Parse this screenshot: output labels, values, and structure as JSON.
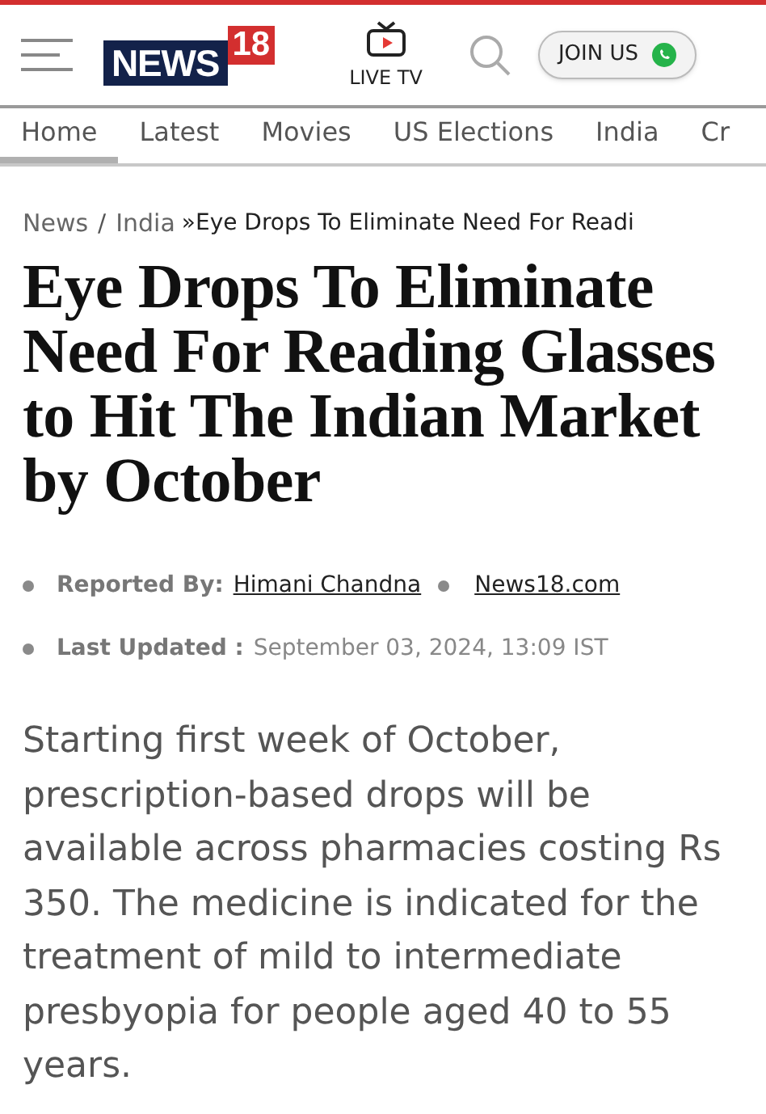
{
  "header": {
    "logo": {
      "word": "NEWS",
      "number": "18"
    },
    "live_tv": "LIVE TV",
    "join_button": "JOIN US"
  },
  "nav": [
    {
      "label": "Home",
      "selected": true
    },
    {
      "label": "Latest",
      "selected": false
    },
    {
      "label": "Movies",
      "selected": false
    },
    {
      "label": "US Elections",
      "selected": false
    },
    {
      "label": "India",
      "selected": false
    },
    {
      "label": "Cr",
      "selected": false
    }
  ],
  "breadcrumb": {
    "items": [
      "News",
      "India"
    ],
    "separator": "/",
    "current": "»Eye Drops To Eliminate Need For Readi"
  },
  "article": {
    "title": "Eye Drops To Eliminate Need For Reading Glasses to Hit The Indian Market by October",
    "reported_by_label": "Reported By:",
    "author": "Himani Chandna",
    "source": "News18.com",
    "updated_label": "Last Updated :",
    "updated": "September 03, 2024, 13:09 IST",
    "body": "Starting first week of October, prescription-based drops will be available across pharmacies costing Rs 350. The medicine is indicated for the treatment of mild to intermediate presbyopia for people aged 40 to 55 years."
  }
}
